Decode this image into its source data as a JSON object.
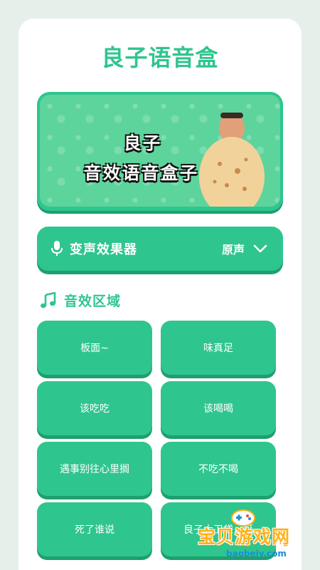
{
  "app": {
    "title": "良子语音盒"
  },
  "banner": {
    "line1": "良子",
    "line2": "音效语音盒子"
  },
  "voice_changer": {
    "label": "变声效果器",
    "value": "原声",
    "icon": "microphone-icon",
    "dropdown_icon": "chevron-down-icon"
  },
  "sound_section": {
    "title": "音效区域",
    "icon": "music-note-icon"
  },
  "sound_buttons": [
    "板面~",
    "味真足",
    "该吃吃",
    "该喝喝",
    "遇事别往心里搁",
    "不吃不喝",
    "死了谁说",
    "良子大卫袋，挺"
  ],
  "watermark": {
    "text": "宝贝游戏网",
    "url_text": "baobeiy.com"
  },
  "colors": {
    "accent": "#2fc58f",
    "accent_dark": "#1f9f6f",
    "background": "#e7efeb",
    "watermark": "#ffb21a"
  }
}
